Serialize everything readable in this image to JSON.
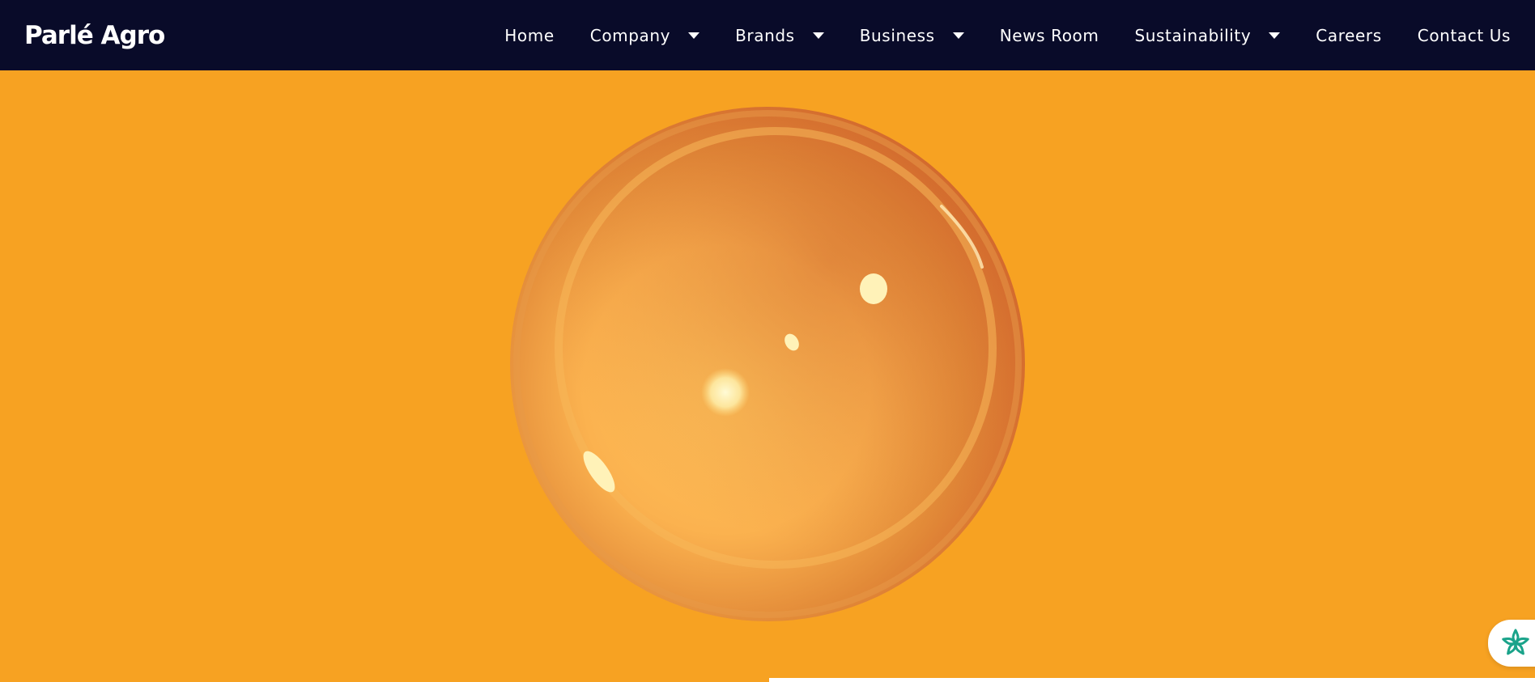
{
  "brand": {
    "logo_text": "Parlé Agro"
  },
  "nav": {
    "items": [
      {
        "label": "Home",
        "has_dropdown": false
      },
      {
        "label": "Company",
        "has_dropdown": true
      },
      {
        "label": "Brands",
        "has_dropdown": true
      },
      {
        "label": "Business",
        "has_dropdown": true
      },
      {
        "label": "News Room",
        "has_dropdown": false
      },
      {
        "label": "Sustainability",
        "has_dropdown": true
      },
      {
        "label": "Careers",
        "has_dropdown": false
      },
      {
        "label": "Contact Us",
        "has_dropdown": false
      }
    ]
  },
  "hero": {
    "visual": "orange-glass-bubble"
  },
  "chat_widget": {
    "icon": "ai-sparkle-icon"
  },
  "colors": {
    "navbar_bg": "#090b29",
    "hero_bg": "#f7a222",
    "nav_text": "#ffffff",
    "widget_icon": "#1aa38a"
  }
}
